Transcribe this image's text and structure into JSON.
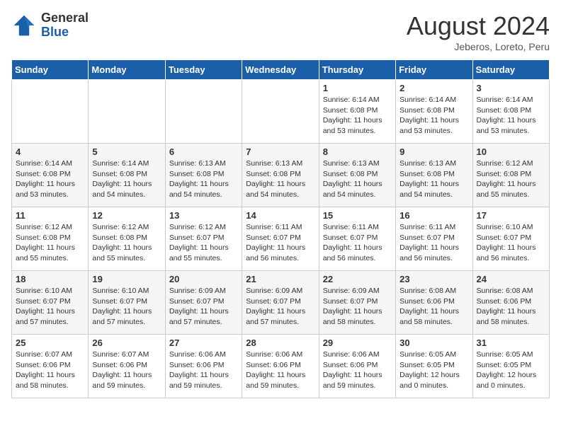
{
  "header": {
    "logo_general": "General",
    "logo_blue": "Blue",
    "month_title": "August 2024",
    "location": "Jeberos, Loreto, Peru"
  },
  "days_of_week": [
    "Sunday",
    "Monday",
    "Tuesday",
    "Wednesday",
    "Thursday",
    "Friday",
    "Saturday"
  ],
  "weeks": [
    [
      {
        "day": "",
        "info": ""
      },
      {
        "day": "",
        "info": ""
      },
      {
        "day": "",
        "info": ""
      },
      {
        "day": "",
        "info": ""
      },
      {
        "day": "1",
        "info": "Sunrise: 6:14 AM\nSunset: 6:08 PM\nDaylight: 11 hours\nand 53 minutes."
      },
      {
        "day": "2",
        "info": "Sunrise: 6:14 AM\nSunset: 6:08 PM\nDaylight: 11 hours\nand 53 minutes."
      },
      {
        "day": "3",
        "info": "Sunrise: 6:14 AM\nSunset: 6:08 PM\nDaylight: 11 hours\nand 53 minutes."
      }
    ],
    [
      {
        "day": "4",
        "info": "Sunrise: 6:14 AM\nSunset: 6:08 PM\nDaylight: 11 hours\nand 53 minutes."
      },
      {
        "day": "5",
        "info": "Sunrise: 6:14 AM\nSunset: 6:08 PM\nDaylight: 11 hours\nand 54 minutes."
      },
      {
        "day": "6",
        "info": "Sunrise: 6:13 AM\nSunset: 6:08 PM\nDaylight: 11 hours\nand 54 minutes."
      },
      {
        "day": "7",
        "info": "Sunrise: 6:13 AM\nSunset: 6:08 PM\nDaylight: 11 hours\nand 54 minutes."
      },
      {
        "day": "8",
        "info": "Sunrise: 6:13 AM\nSunset: 6:08 PM\nDaylight: 11 hours\nand 54 minutes."
      },
      {
        "day": "9",
        "info": "Sunrise: 6:13 AM\nSunset: 6:08 PM\nDaylight: 11 hours\nand 54 minutes."
      },
      {
        "day": "10",
        "info": "Sunrise: 6:12 AM\nSunset: 6:08 PM\nDaylight: 11 hours\nand 55 minutes."
      }
    ],
    [
      {
        "day": "11",
        "info": "Sunrise: 6:12 AM\nSunset: 6:08 PM\nDaylight: 11 hours\nand 55 minutes."
      },
      {
        "day": "12",
        "info": "Sunrise: 6:12 AM\nSunset: 6:08 PM\nDaylight: 11 hours\nand 55 minutes."
      },
      {
        "day": "13",
        "info": "Sunrise: 6:12 AM\nSunset: 6:07 PM\nDaylight: 11 hours\nand 55 minutes."
      },
      {
        "day": "14",
        "info": "Sunrise: 6:11 AM\nSunset: 6:07 PM\nDaylight: 11 hours\nand 56 minutes."
      },
      {
        "day": "15",
        "info": "Sunrise: 6:11 AM\nSunset: 6:07 PM\nDaylight: 11 hours\nand 56 minutes."
      },
      {
        "day": "16",
        "info": "Sunrise: 6:11 AM\nSunset: 6:07 PM\nDaylight: 11 hours\nand 56 minutes."
      },
      {
        "day": "17",
        "info": "Sunrise: 6:10 AM\nSunset: 6:07 PM\nDaylight: 11 hours\nand 56 minutes."
      }
    ],
    [
      {
        "day": "18",
        "info": "Sunrise: 6:10 AM\nSunset: 6:07 PM\nDaylight: 11 hours\nand 57 minutes."
      },
      {
        "day": "19",
        "info": "Sunrise: 6:10 AM\nSunset: 6:07 PM\nDaylight: 11 hours\nand 57 minutes."
      },
      {
        "day": "20",
        "info": "Sunrise: 6:09 AM\nSunset: 6:07 PM\nDaylight: 11 hours\nand 57 minutes."
      },
      {
        "day": "21",
        "info": "Sunrise: 6:09 AM\nSunset: 6:07 PM\nDaylight: 11 hours\nand 57 minutes."
      },
      {
        "day": "22",
        "info": "Sunrise: 6:09 AM\nSunset: 6:07 PM\nDaylight: 11 hours\nand 58 minutes."
      },
      {
        "day": "23",
        "info": "Sunrise: 6:08 AM\nSunset: 6:06 PM\nDaylight: 11 hours\nand 58 minutes."
      },
      {
        "day": "24",
        "info": "Sunrise: 6:08 AM\nSunset: 6:06 PM\nDaylight: 11 hours\nand 58 minutes."
      }
    ],
    [
      {
        "day": "25",
        "info": "Sunrise: 6:07 AM\nSunset: 6:06 PM\nDaylight: 11 hours\nand 58 minutes."
      },
      {
        "day": "26",
        "info": "Sunrise: 6:07 AM\nSunset: 6:06 PM\nDaylight: 11 hours\nand 59 minutes."
      },
      {
        "day": "27",
        "info": "Sunrise: 6:06 AM\nSunset: 6:06 PM\nDaylight: 11 hours\nand 59 minutes."
      },
      {
        "day": "28",
        "info": "Sunrise: 6:06 AM\nSunset: 6:06 PM\nDaylight: 11 hours\nand 59 minutes."
      },
      {
        "day": "29",
        "info": "Sunrise: 6:06 AM\nSunset: 6:06 PM\nDaylight: 11 hours\nand 59 minutes."
      },
      {
        "day": "30",
        "info": "Sunrise: 6:05 AM\nSunset: 6:05 PM\nDaylight: 12 hours\nand 0 minutes."
      },
      {
        "day": "31",
        "info": "Sunrise: 6:05 AM\nSunset: 6:05 PM\nDaylight: 12 hours\nand 0 minutes."
      }
    ]
  ]
}
